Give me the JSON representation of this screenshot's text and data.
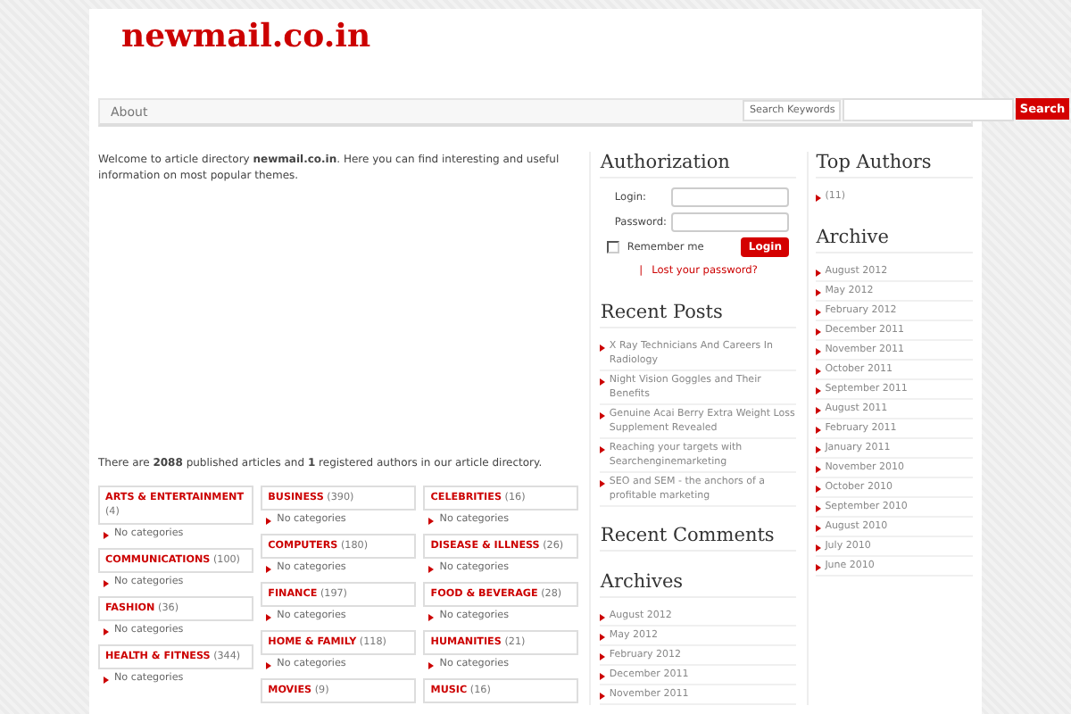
{
  "site_title": "newmail.co.in",
  "nav": [
    {
      "label": "About"
    }
  ],
  "search": {
    "placeholder": "Search Keywords",
    "button": "Search"
  },
  "intro": "Welcome to article directory **newmail.co.in**. Here you can find interesting and useful information on most popular themes.",
  "stats": "There are **2088** published articles and **1** registered authors in our article directory.",
  "category_columns": [
    {
      "categories": [
        {
          "name": "ARTS & ENTERTAINMENT",
          "count": "(4)",
          "sub": "No categories"
        },
        {
          "name": "COMMUNICATIONS",
          "count": "(100)",
          "sub": "No categories"
        },
        {
          "name": "FASHION",
          "count": "(36)",
          "sub": "No categories"
        },
        {
          "name": "HEALTH & FITNESS",
          "count": "(344)",
          "sub": "No categories"
        }
      ]
    },
    {
      "categories": [
        {
          "name": "BUSINESS",
          "count": "(390)",
          "sub": "No categories"
        },
        {
          "name": "COMPUTERS",
          "count": "(180)",
          "sub": "No categories"
        },
        {
          "name": "FINANCE",
          "count": "(197)",
          "sub": "No categories"
        },
        {
          "name": "HOME & FAMILY",
          "count": "(118)",
          "sub": "No categories"
        },
        {
          "name": "MOVIES",
          "count": "(9)"
        }
      ]
    },
    {
      "categories": [
        {
          "name": "CELEBRITIES",
          "count": "(16)",
          "sub": "No categories"
        },
        {
          "name": "DISEASE & ILLNESS",
          "count": "(26)",
          "sub": "No categories"
        },
        {
          "name": "FOOD & BEVERAGE",
          "count": "(28)",
          "sub": "No categories"
        },
        {
          "name": "HUMANITIES",
          "count": "(21)",
          "sub": "No categories"
        },
        {
          "name": "MUSIC",
          "count": "(16)"
        }
      ]
    }
  ],
  "authorization": {
    "title": "Authorization",
    "login_label": "Login:",
    "password_label": "Password:",
    "remember": {
      "label": "Remember me",
      "checked": false
    },
    "button": "Login",
    "separator": "|",
    "lost_password": "Lost your password?"
  },
  "recent_posts": {
    "title": "Recent Posts",
    "items": [
      "X Ray Technicians And Careers In Radiology",
      "Night Vision Goggles and Their Benefits",
      "Genuine Acai Berry Extra Weight Loss Supplement Revealed",
      "Reaching your targets with Searchenginemarketing",
      "SEO and SEM - the anchors of a profitable marketing"
    ]
  },
  "recent_comments": {
    "title": "Recent Comments"
  },
  "archives": {
    "title": "Archives",
    "items": [
      "August 2012",
      "May 2012",
      "February 2012",
      "December 2011",
      "November 2011"
    ]
  },
  "top_authors": {
    "title": "Top Authors",
    "items": [
      "(11)"
    ]
  },
  "archive": {
    "title": "Archive",
    "items": [
      "August 2012",
      "May 2012",
      "February 2012",
      "December 2011",
      "November 2011",
      "October 2011",
      "September 2011",
      "August 2011",
      "February 2011",
      "January 2011",
      "November 2010",
      "October 2010",
      "September 2010",
      "August 2010",
      "July 2010",
      "June 2010"
    ]
  }
}
